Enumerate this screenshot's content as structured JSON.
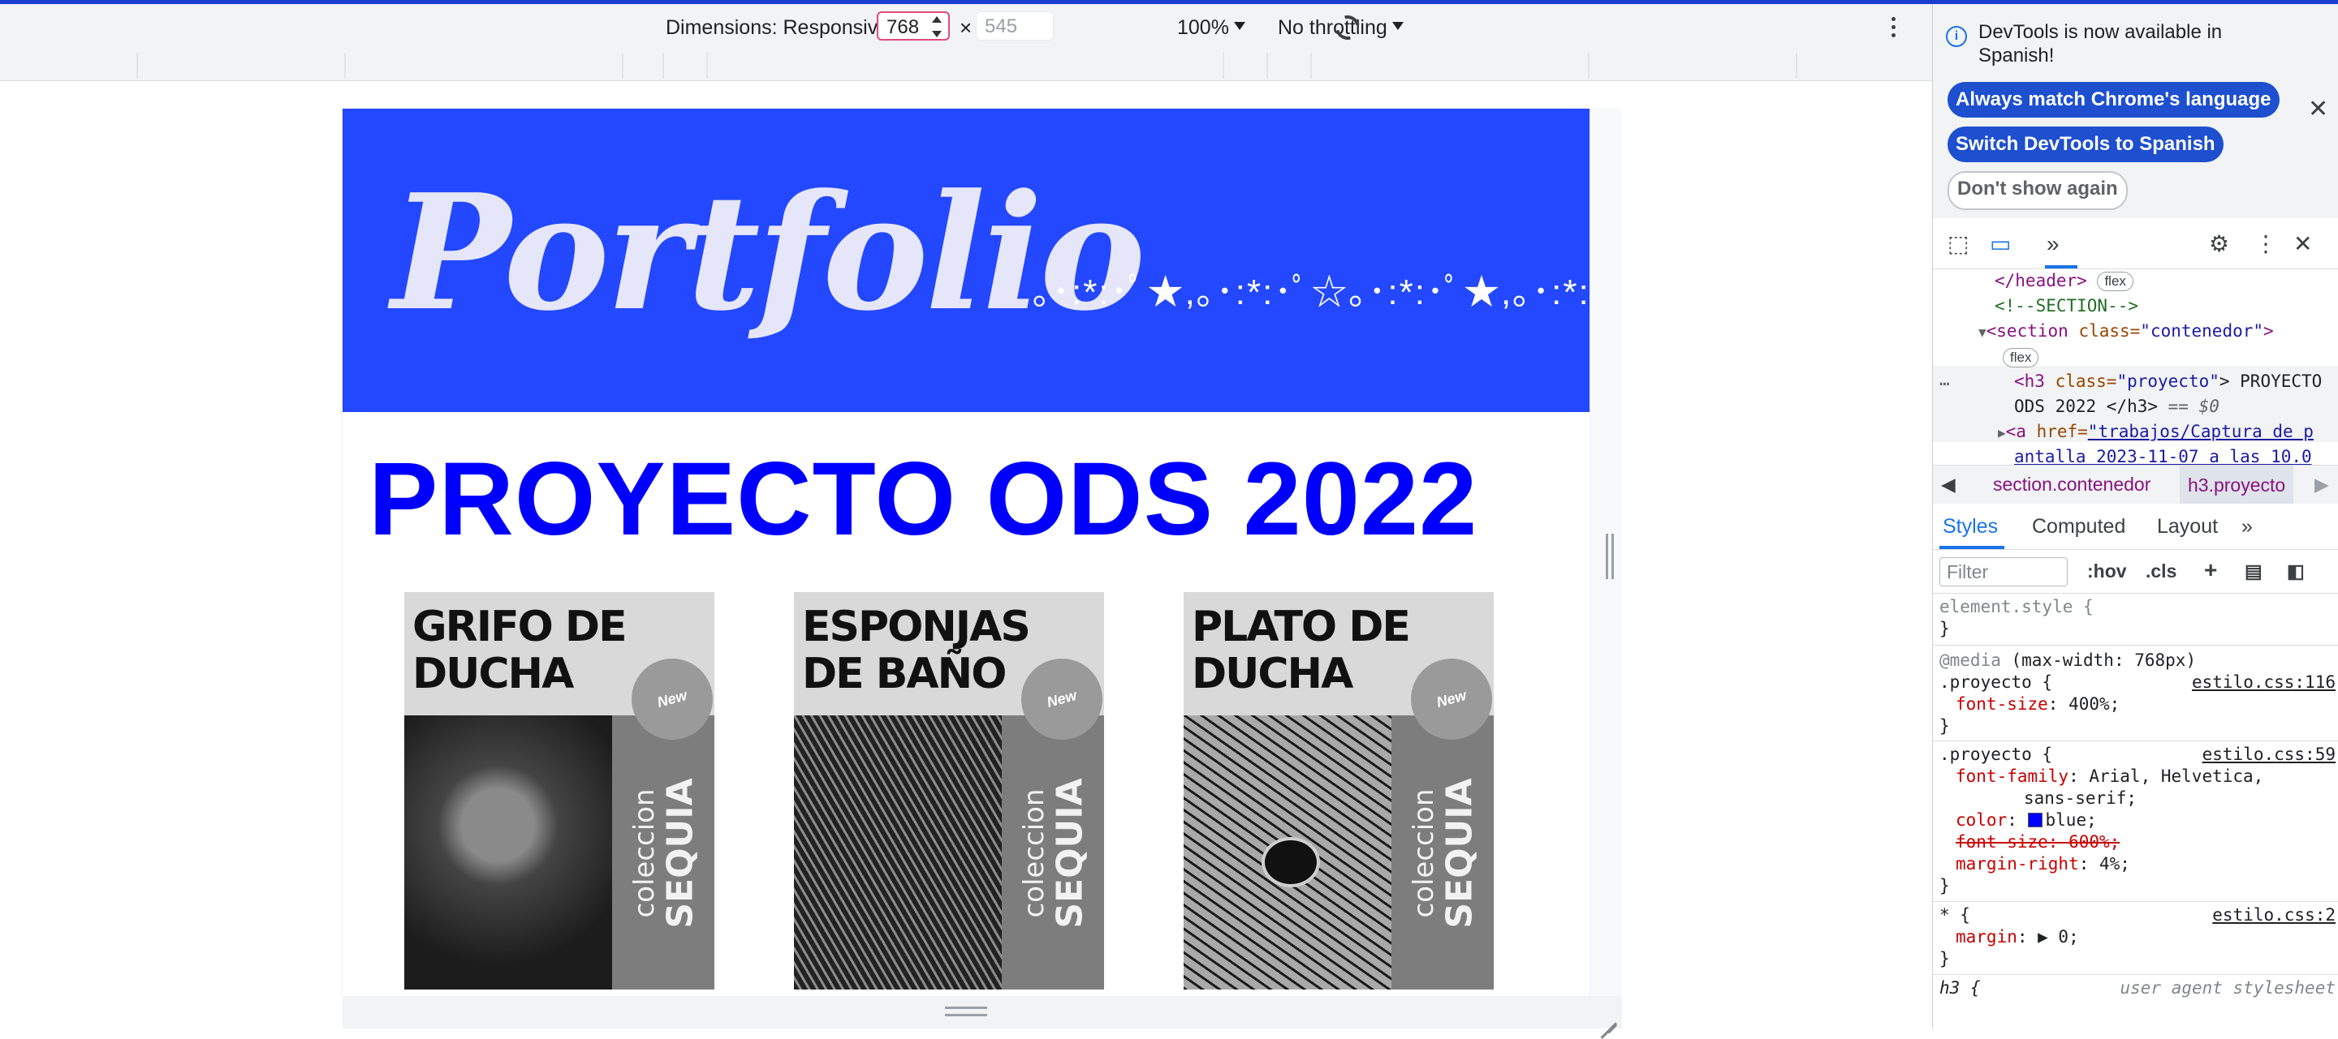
{
  "device_toolbar": {
    "dimensions_label": "Dimensions: Responsive",
    "width_value": "768",
    "height_placeholder": "545",
    "times": "×",
    "zoom": "100%",
    "throttling": "No throttling"
  },
  "page": {
    "title": "Portfolio",
    "sparkles": "｡･:*:･ﾟ★,｡･:*:･ﾟ☆｡･:*:･ﾟ★,｡･:*:･ﾟ",
    "heading": "PROYECTO ODS 2022",
    "cards": [
      {
        "title": "GRIFO DE DUCHA",
        "badge": "New",
        "collection": "coleccion",
        "series": "SEQUIA"
      },
      {
        "title": "ESPONJAS DE BAÑO",
        "badge": "New",
        "collection": "coleccion",
        "series": "SEQUIA"
      },
      {
        "title": "PLATO DE DUCHA",
        "badge": "New",
        "collection": "coleccion",
        "series": "SEQUIA"
      }
    ]
  },
  "devtools": {
    "info": "DevTools is now available in Spanish!",
    "btn_match": "Always match Chrome's language",
    "btn_switch": "Switch DevTools to Spanish",
    "btn_dismiss": "Don't show again",
    "dom": {
      "header_close": "</header>",
      "flex": "flex",
      "comment": "<!--SECTION-->",
      "section_open_tag": "<section ",
      "section_attr": "class=",
      "section_val": "\"contenedor\"",
      "section_close": ">",
      "h3_tag": "<h3 ",
      "h3_attr": "class=",
      "h3_val": "\"proyecto\"",
      "h3_text": "> PROYECTO",
      "h3_text2": "ODS 2022 </h3>",
      "h3_eq": " == $0",
      "a_tag": "<a ",
      "a_attr": "href=",
      "a_val": "\"trabajos/Captura de p",
      "a_line2": "antalla 2023-11-07 a las 10.0"
    },
    "breadcrumb_1": "section.contenedor",
    "breadcrumb_2": "h3.proyecto",
    "tabs": {
      "styles": "Styles",
      "computed": "Computed",
      "layout": "Layout"
    },
    "filter_placeholder": "Filter",
    "hov": ":hov",
    "cls": ".cls",
    "rules": {
      "element_style": "element.style {",
      "close": "}",
      "media": "@media",
      "media_cond": "(max-width: 768px)",
      "proyecto_sel": ".proyecto {",
      "src1": "estilo.css:116",
      "fs1_prop": "font-size",
      "fs1_val": ": 400%;",
      "src2": "estilo.css:59",
      "ff_prop": "font-family",
      "ff_val": ": Arial, Helvetica,",
      "ff_val2": "sans-serif;",
      "color_prop": "color",
      "color_val": "blue;",
      "fs2": "font-size: 600%;",
      "mr_prop": "margin-right",
      "mr_val": ": 4%;",
      "star_sel": "* {",
      "src3": "estilo.css:2",
      "margin_prop": "margin",
      "margin_val": ": ▶ 0;",
      "h3_sel": "h3 {",
      "ua": "user agent stylesheet"
    }
  }
}
